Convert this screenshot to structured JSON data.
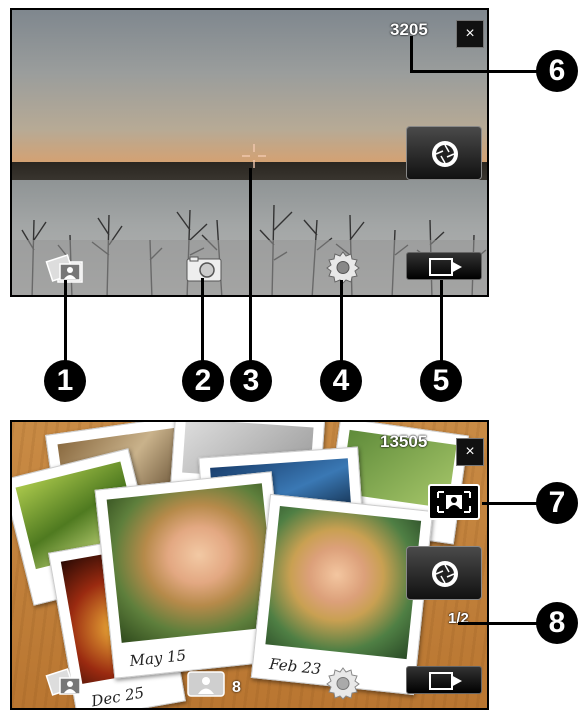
{
  "screen1": {
    "shot_counter": "3205",
    "close_label": "×"
  },
  "screen2": {
    "shot_counter": "13505",
    "close_label": "×",
    "page_indicator": "1/2",
    "album_count": "8",
    "photo_captions": [
      "May 15",
      "Feb 23",
      "Dec 25"
    ]
  },
  "callouts": [
    "1",
    "2",
    "3",
    "4",
    "5",
    "6",
    "7",
    "8"
  ],
  "icons": {
    "album": "album-icon",
    "capture_mode": "camera-mode-icon",
    "focus": "focus-indicator-icon",
    "settings": "gear-icon",
    "review": "review-icon",
    "shutter": "shutter-icon",
    "close": "close-icon",
    "frame": "frame-template-icon"
  }
}
